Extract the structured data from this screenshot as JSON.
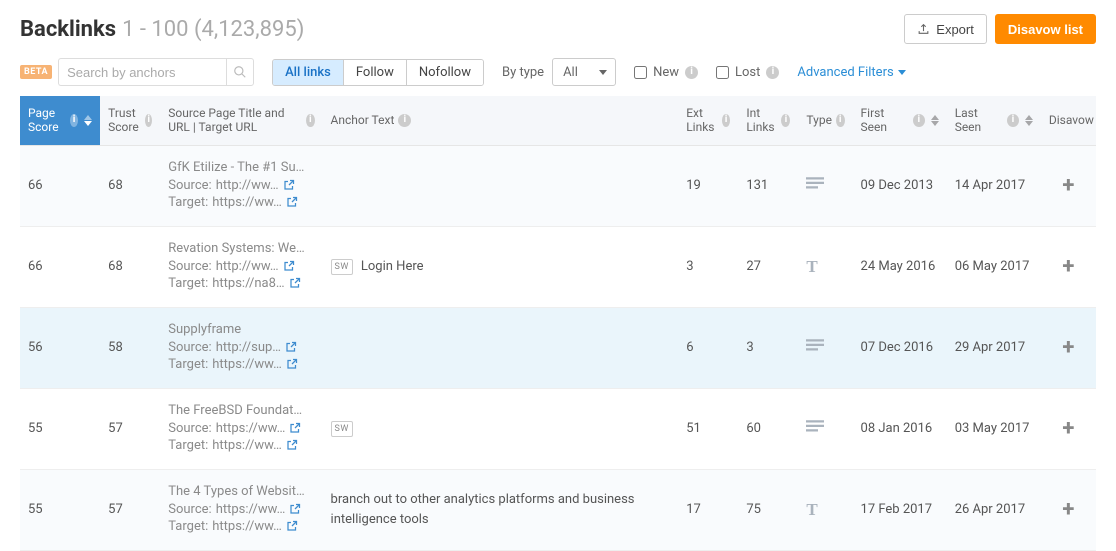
{
  "header": {
    "title": "Backlinks",
    "range": "1 - 100 (4,123,895)",
    "export_label": "Export",
    "disavow_label": "Disavow list"
  },
  "toolbar": {
    "beta_label": "BETA",
    "search_placeholder": "Search by anchors",
    "tabs": {
      "all": "All links",
      "follow": "Follow",
      "nofollow": "Nofollow"
    },
    "by_type_label": "By type",
    "select_value": "All",
    "new_label": "New",
    "lost_label": "Lost",
    "advanced_filters": "Advanced Filters"
  },
  "columns": {
    "page_score": "Page Score",
    "trust_score": "Trust Score",
    "source": "Source Page Title and URL | Target URL",
    "anchor": "Anchor Text",
    "ext_links": "Ext Links",
    "int_links": "Int Links",
    "type": "Type",
    "first_seen": "First Seen",
    "last_seen": "Last Seen",
    "disavow": "Disavow"
  },
  "labels": {
    "source": "Source:",
    "target": "Target:",
    "sw": "SW"
  },
  "rows": [
    {
      "page_score": "66",
      "trust_score": "68",
      "title": "GfK Etilize - The #1 Su…",
      "source_url": "http://ww…",
      "target_url": "https://ww…",
      "sw": false,
      "anchor": "",
      "ext": "19",
      "int": "131",
      "type": "text",
      "first_seen": "09 Dec 2013",
      "last_seen": "14 Apr 2017",
      "highlight": false
    },
    {
      "page_score": "66",
      "trust_score": "68",
      "title": "Revation Systems: We…",
      "source_url": "http://ww…",
      "target_url": "https://na8…",
      "sw": true,
      "anchor": "Login Here",
      "ext": "3",
      "int": "27",
      "type": "T",
      "first_seen": "24 May 2016",
      "last_seen": "06 May 2017",
      "highlight": false
    },
    {
      "page_score": "56",
      "trust_score": "58",
      "title": "Supplyframe",
      "source_url": "http://sup…",
      "target_url": "https://ww…",
      "sw": false,
      "anchor": "",
      "ext": "6",
      "int": "3",
      "type": "text",
      "first_seen": "07 Dec 2016",
      "last_seen": "29 Apr 2017",
      "highlight": true
    },
    {
      "page_score": "55",
      "trust_score": "57",
      "title": "The FreeBSD Foundat…",
      "source_url": "https://ww…",
      "target_url": "https://ww…",
      "sw": true,
      "anchor": "",
      "ext": "51",
      "int": "60",
      "type": "text",
      "first_seen": "08 Jan 2016",
      "last_seen": "03 May 2017",
      "highlight": false
    },
    {
      "page_score": "55",
      "trust_score": "57",
      "title": "The 4 Types of Websit…",
      "source_url": "https://ww…",
      "target_url": "https://ww…",
      "sw": false,
      "anchor": "branch out to other analytics platforms and business intelligence tools",
      "ext": "17",
      "int": "75",
      "type": "T",
      "first_seen": "17 Feb 2017",
      "last_seen": "26 Apr 2017",
      "highlight": false
    }
  ]
}
